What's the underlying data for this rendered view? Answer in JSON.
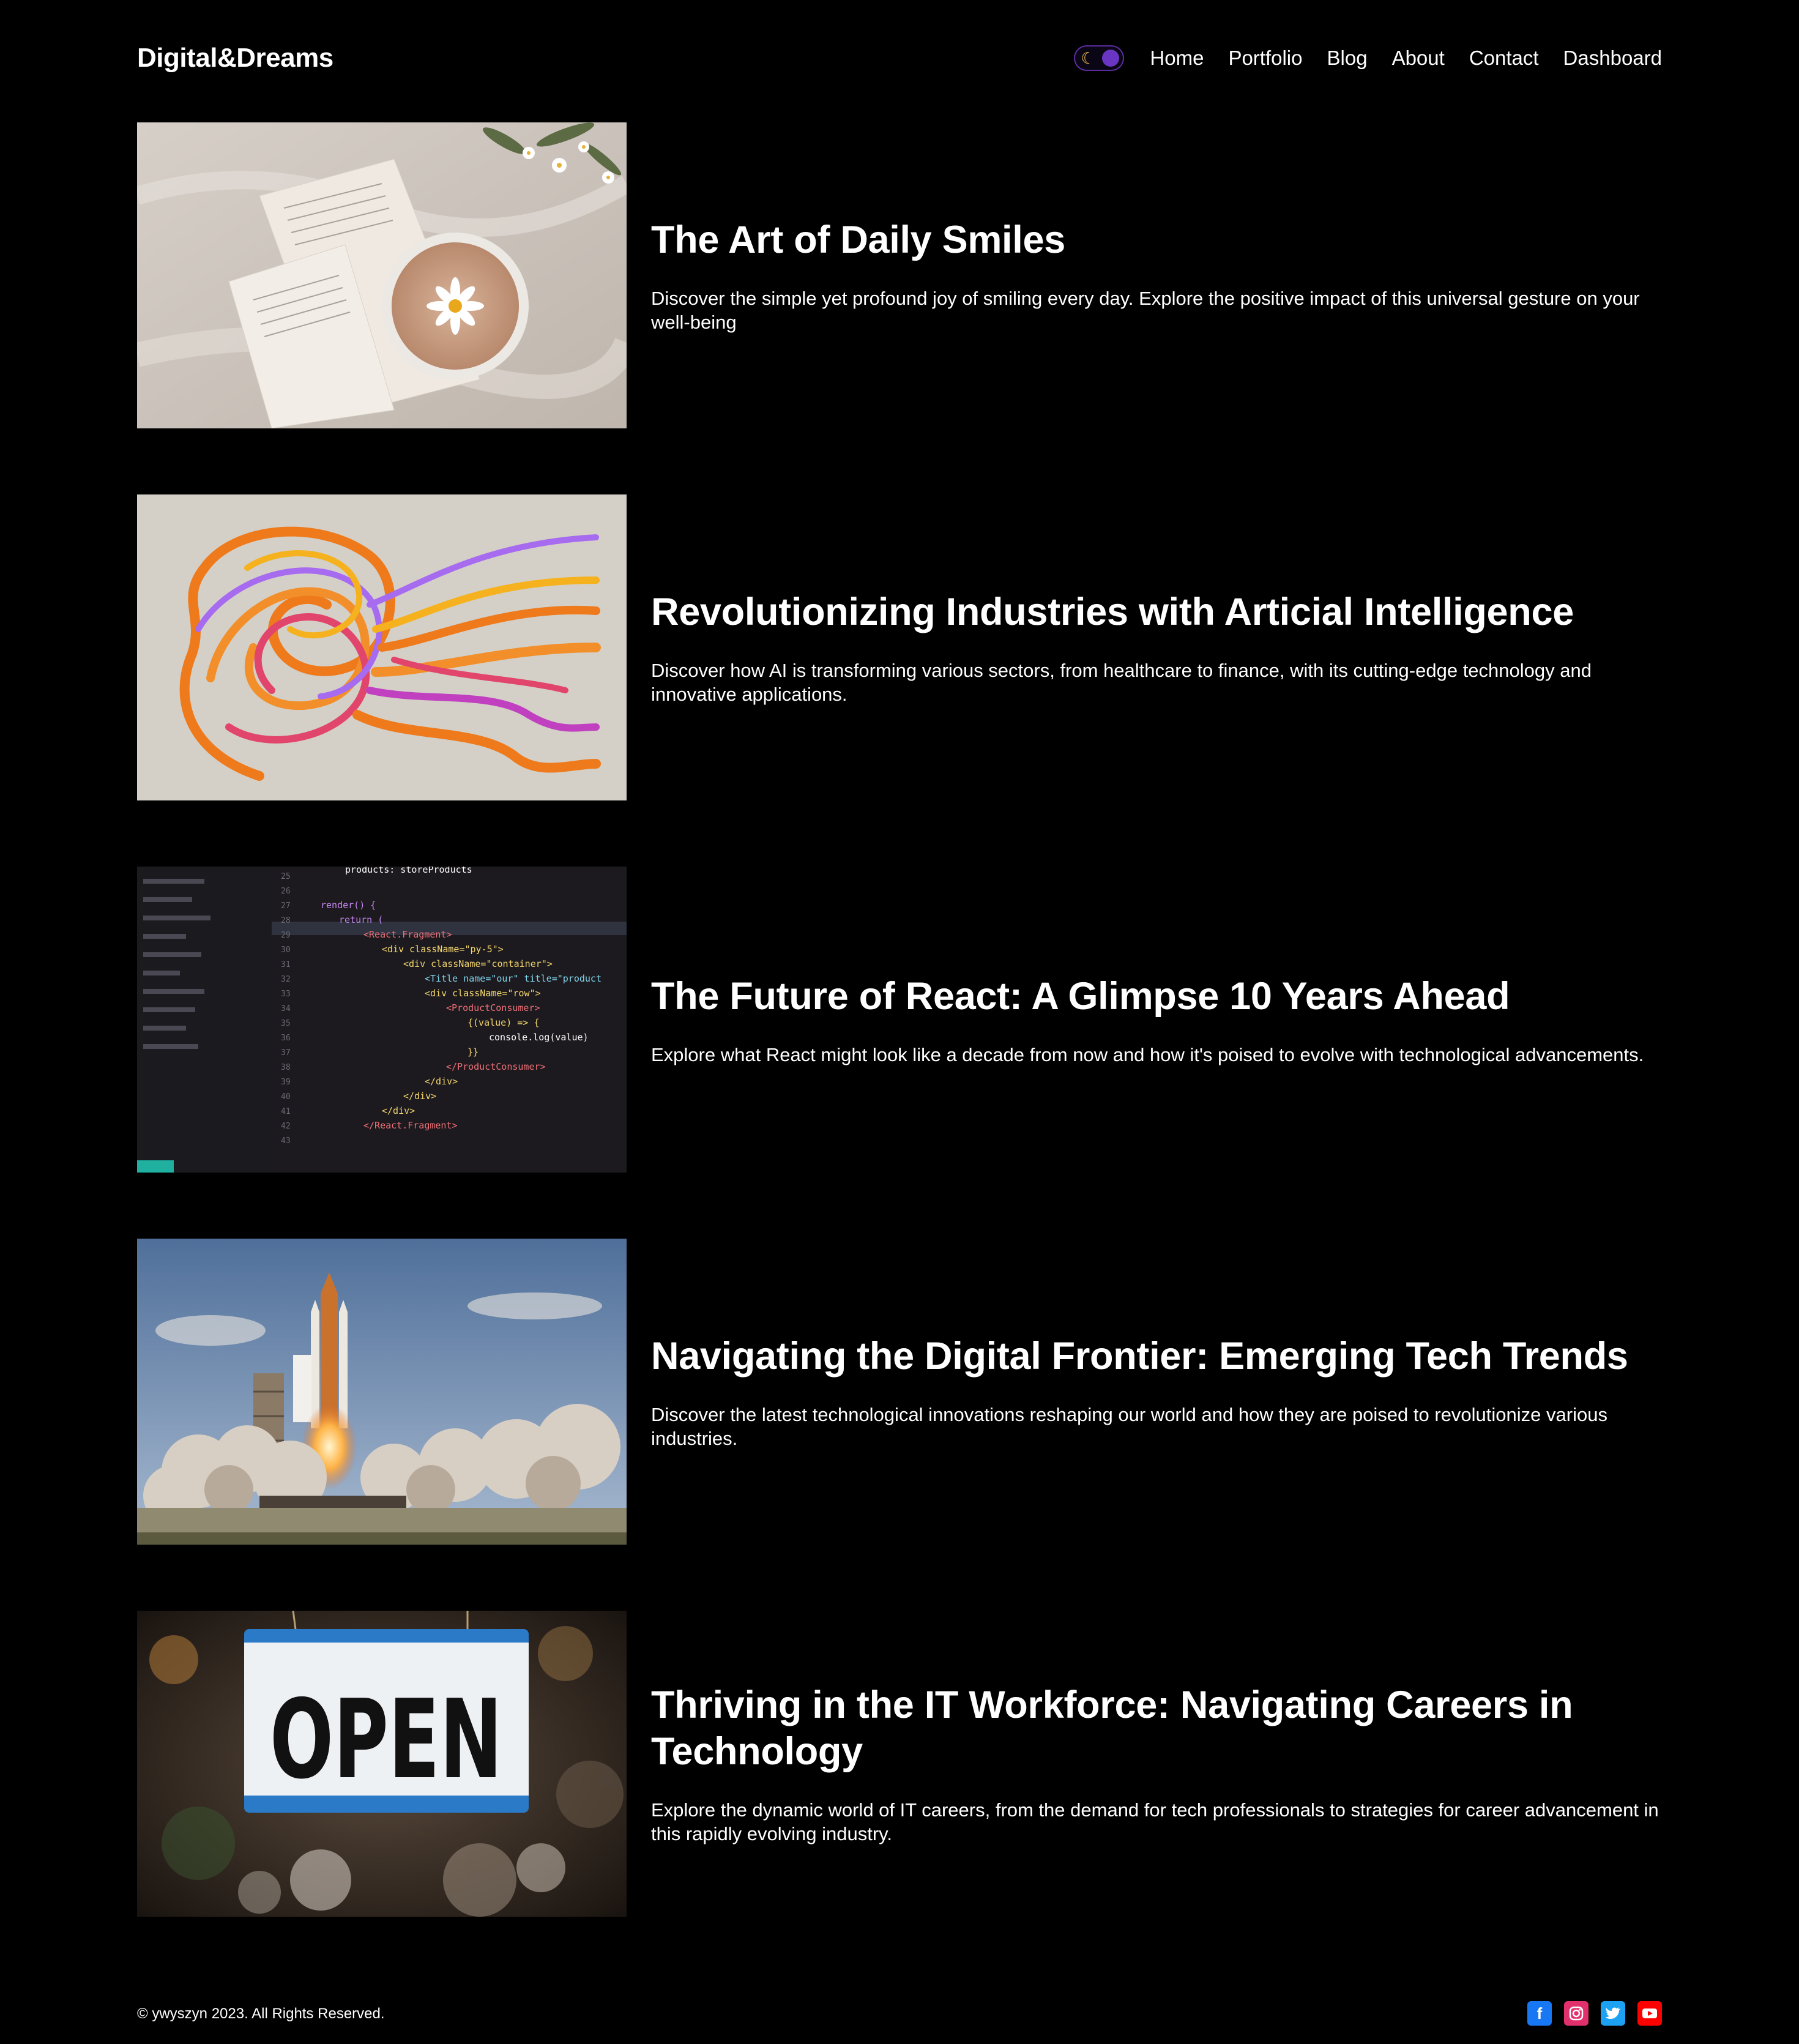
{
  "brand": "Digital&Dreams",
  "theme_toggle": {
    "icon": "moon-icon",
    "state": "dark"
  },
  "nav": {
    "home": "Home",
    "portfolio": "Portfolio",
    "blog": "Blog",
    "about": "About",
    "contact": "Contact",
    "dashboard": "Dashboard"
  },
  "posts": [
    {
      "title": "The Art of Daily Smiles",
      "description": "Discover the simple yet profound joy of smiling every day. Explore the positive impact of this universal gesture on your well-being",
      "image": "coffee-cup-with-daisy-photo"
    },
    {
      "title": "Revolutionizing Industries with Articial Intelligence",
      "description": "Discover how AI is transforming various sectors, from healthcare to finance, with its cutting-edge technology and innovative applications.",
      "image": "colorful-yarn-head-photo"
    },
    {
      "title": "The Future of React: A Glimpse 10 Years Ahead",
      "description": "Explore what React might look like a decade from now and how it's poised to evolve with technological advancements.",
      "image": "react-code-editor-photo"
    },
    {
      "title": "Navigating the Digital Frontier: Emerging Tech Trends",
      "description": "Discover the latest technological innovations reshaping our world and how they are poised to revolutionize various industries.",
      "image": "space-shuttle-launch-photo"
    },
    {
      "title": "Thriving in the IT Workforce: Navigating Careers in Technology",
      "description": "Explore the dynamic world of IT careers, from the demand for tech professionals to strategies for career advancement in this rapidly evolving industry.",
      "image": "open-sign-photo"
    }
  ],
  "image_text": {
    "code_lines": [
      "products: storeProducts",
      "render() {",
      "return (",
      "<React.Fragment>",
      "<div className=\"py-5\">",
      "<div className=\"container\">",
      "<Title name=\"our\" title=\"product",
      "<div className=\"row\">",
      "<ProductConsumer>",
      "{(value) => {",
      "console.log(value)",
      "}}",
      "</ProductConsumer>",
      "</div>",
      "</div>",
      "</div>",
      "</React.Fragment>"
    ],
    "open_sign": "OPEN"
  },
  "footer": {
    "copyright": "© ywyszyn 2023. All Rights Reserved.",
    "social": [
      "facebook-icon",
      "instagram-icon",
      "twitter-icon",
      "youtube-icon"
    ]
  },
  "colors": {
    "background": "#000000",
    "text": "#ffffff",
    "toggle_accent": "#6b35c4",
    "facebook": "#1877f2",
    "instagram": "#e1306c",
    "twitter": "#1da1f2",
    "youtube": "#ff0000"
  }
}
